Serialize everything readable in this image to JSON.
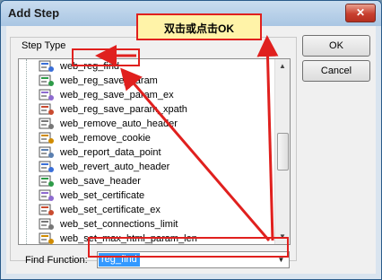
{
  "window": {
    "title": "Add Step",
    "close_glyph": "✕"
  },
  "group_label": "Step Type",
  "list": {
    "items": [
      {
        "label": "web_reg_find",
        "icon": "reg-find-icon"
      },
      {
        "label": "web_reg_save_param",
        "icon": "save-param-icon"
      },
      {
        "label": "web_reg_save_param_ex",
        "icon": "save-param-ex-icon"
      },
      {
        "label": "web_reg_save_param_xpath",
        "icon": "save-param-xpath-icon"
      },
      {
        "label": "web_remove_auto_header",
        "icon": "head-icon"
      },
      {
        "label": "web_remove_cookie",
        "icon": "cookie-icon"
      },
      {
        "label": "web_report_data_point",
        "icon": "report-icon"
      },
      {
        "label": "web_revert_auto_header",
        "icon": "head-icon"
      },
      {
        "label": "web_save_header",
        "icon": "head-icon"
      },
      {
        "label": "web_set_certificate",
        "icon": "certificate-icon"
      },
      {
        "label": "web_set_certificate_ex",
        "icon": "certificate-ex-icon"
      },
      {
        "label": "web_set_connections_limit",
        "icon": "connections-icon"
      },
      {
        "label": "web_set_max_html_param_len",
        "icon": "param-len-icon"
      }
    ]
  },
  "find_function": {
    "label": "Find Function:",
    "value": "reg_find"
  },
  "buttons": {
    "ok": "OK",
    "cancel": "Cancel"
  },
  "annotation": {
    "callout": "双击或点击OK",
    "color": "#e0201e"
  },
  "scrollbar": {
    "up": "▲",
    "down": "▼"
  },
  "combo_arrow": "▼"
}
